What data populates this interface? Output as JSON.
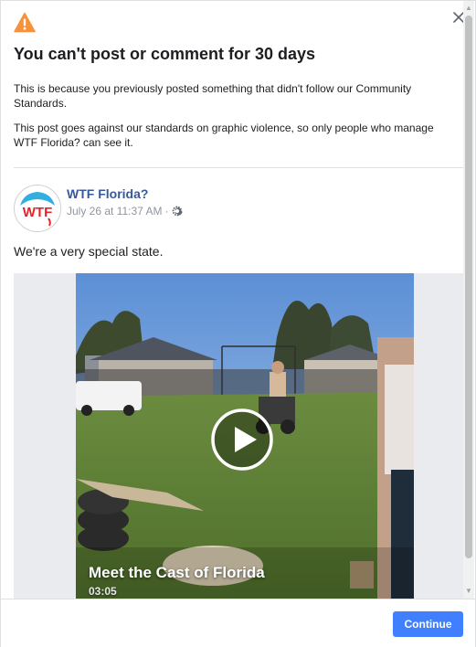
{
  "dialog": {
    "title": "You can't post or comment for 30 days",
    "paragraph1": "This is because you previously posted something that didn't follow our Community Standards.",
    "paragraph2": "This post goes against our standards on graphic violence, so only people who manage WTF Florida? can see it.",
    "icons": {
      "warning": "warning-icon",
      "close": "close-icon"
    },
    "colors": {
      "warning": "#f7923b",
      "link": "#385898",
      "accent": "#4080ff"
    }
  },
  "post": {
    "page_name": "WTF Florida?",
    "timestamp": "July 26 at 11:37 AM",
    "separator": "·",
    "privacy_icon": "gear-icon",
    "text": "We're a very special state.",
    "avatar_logo_text": "WTF"
  },
  "video": {
    "title": "Meet the Cast of Florida",
    "duration": "03:05",
    "play_icon": "play-icon"
  },
  "footer": {
    "continue_label": "Continue"
  }
}
